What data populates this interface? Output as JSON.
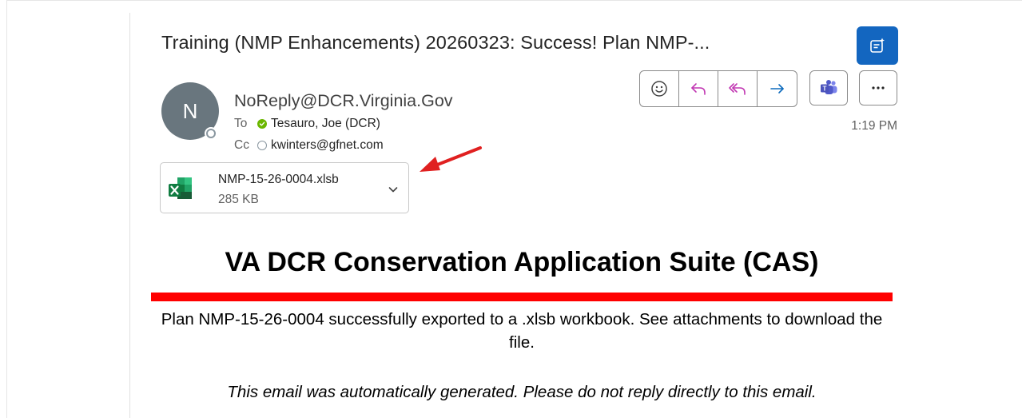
{
  "email": {
    "subject": "Training (NMP Enhancements) 20260323: Success! Plan NMP-...",
    "sender": "NoReply@DCR.Virginia.Gov",
    "avatar_initial": "N",
    "to_label": "To",
    "to_name": "Tesauro, Joe (DCR)",
    "cc_label": "Cc",
    "cc_name": "kwinters@gfnet.com",
    "time": "1:19 PM"
  },
  "attachment": {
    "filename": "NMP-15-26-0004.xlsb",
    "size": "285 KB",
    "icon": "excel-icon"
  },
  "toolbar": {
    "icons": [
      "emoji-icon",
      "reply-icon",
      "reply-all-icon",
      "forward-icon",
      "teams-icon",
      "more-icon"
    ],
    "copilot_icon": "copilot-summary-icon"
  },
  "body": {
    "heading": "VA DCR Conservation Application Suite (CAS)",
    "message": "Plan NMP-15-26-0004 successfully exported to a .xlsb workbook. See attachments to download the file.",
    "footer": "This email was automatically generated. Please do not reply directly to this email."
  },
  "colors": {
    "accent_blue": "#1366c0",
    "red_bar": "#ff0000",
    "presence_green": "#6bb700",
    "avatar_gray": "#69767e",
    "reply_purple": "#c239b3",
    "forward_blue": "#0f6cbd"
  }
}
